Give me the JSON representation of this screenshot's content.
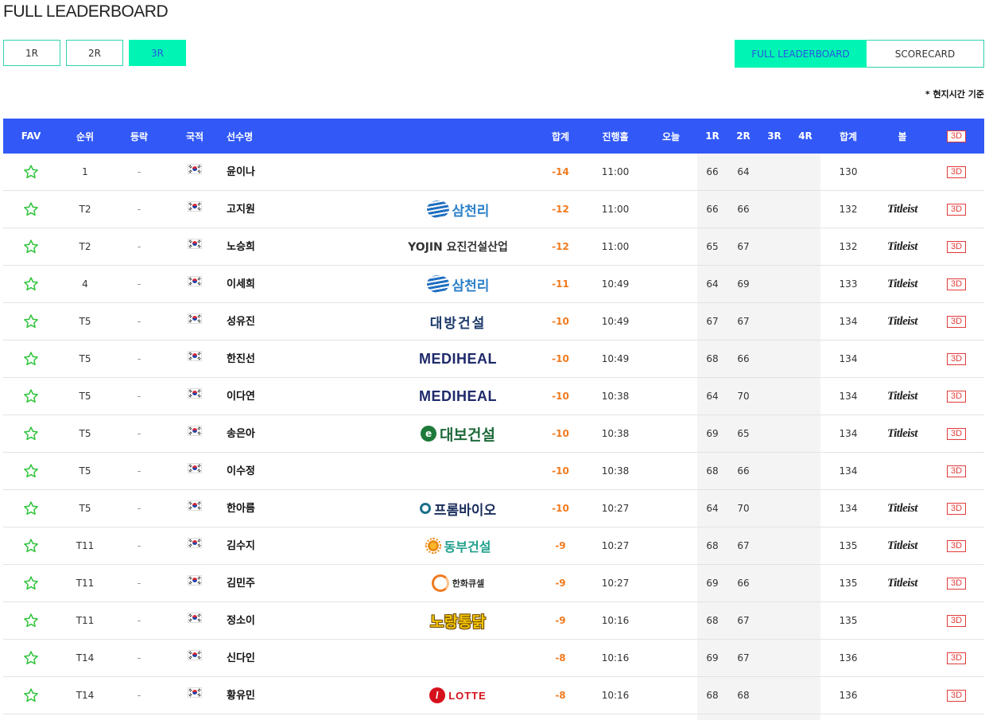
{
  "page_title": "FULL LEADERBOARD",
  "round_tabs": [
    "1R",
    "2R",
    "3R"
  ],
  "active_round": "3R",
  "view_tabs": {
    "leaderboard": "FULL LEADERBOARD",
    "scorecard": "SCORECARD"
  },
  "timezone_note": "* 현지시간 기준",
  "columns": {
    "fav": "FAV",
    "rank": "순위",
    "movement": "등락",
    "nation": "국적",
    "player": "선수명",
    "total": "합계",
    "hole": "진행홀",
    "today": "오늘",
    "r1": "1R",
    "r2": "2R",
    "r3": "3R",
    "r4": "4R",
    "sum": "합계",
    "ball": "볼",
    "three_d": "3D"
  },
  "colors": {
    "header_bg": "#3259f7",
    "accent": "#00f5b4",
    "score": "#f07a1e",
    "star": "#2fc43a",
    "three_d": "#e23b3b"
  },
  "rows": [
    {
      "rank": "1",
      "movement": "-",
      "nation_icon": "korea-flag-icon",
      "name": "윤이나",
      "sponsor": "",
      "total": "-14",
      "hole": "11:00",
      "today": "",
      "r1": "66",
      "r2": "64",
      "r3": "",
      "r4": "",
      "sum": "130",
      "ball": "",
      "three_d": "3D"
    },
    {
      "rank": "T2",
      "movement": "-",
      "nation_icon": "korea-flag-icon",
      "name": "고지원",
      "sponsor": "삼천리",
      "total": "-12",
      "hole": "11:00",
      "today": "",
      "r1": "66",
      "r2": "66",
      "r3": "",
      "r4": "",
      "sum": "132",
      "ball": "Titleist",
      "three_d": "3D"
    },
    {
      "rank": "T2",
      "movement": "-",
      "nation_icon": "korea-flag-icon",
      "name": "노승희",
      "sponsor": "YOJIN 요진건설산업",
      "total": "-12",
      "hole": "11:00",
      "today": "",
      "r1": "65",
      "r2": "67",
      "r3": "",
      "r4": "",
      "sum": "132",
      "ball": "Titleist",
      "three_d": "3D"
    },
    {
      "rank": "4",
      "movement": "-",
      "nation_icon": "korea-flag-icon",
      "name": "이세희",
      "sponsor": "삼천리",
      "total": "-11",
      "hole": "10:49",
      "today": "",
      "r1": "64",
      "r2": "69",
      "r3": "",
      "r4": "",
      "sum": "133",
      "ball": "Titleist",
      "three_d": "3D"
    },
    {
      "rank": "T5",
      "movement": "-",
      "nation_icon": "korea-flag-icon",
      "name": "성유진",
      "sponsor": "대방건설",
      "total": "-10",
      "hole": "10:49",
      "today": "",
      "r1": "67",
      "r2": "67",
      "r3": "",
      "r4": "",
      "sum": "134",
      "ball": "Titleist",
      "three_d": "3D"
    },
    {
      "rank": "T5",
      "movement": "-",
      "nation_icon": "korea-flag-icon",
      "name": "한진선",
      "sponsor": "MEDIHEAL",
      "total": "-10",
      "hole": "10:49",
      "today": "",
      "r1": "68",
      "r2": "66",
      "r3": "",
      "r4": "",
      "sum": "134",
      "ball": "",
      "three_d": "3D"
    },
    {
      "rank": "T5",
      "movement": "-",
      "nation_icon": "korea-flag-icon",
      "name": "이다연",
      "sponsor": "MEDIHEAL",
      "total": "-10",
      "hole": "10:38",
      "today": "",
      "r1": "64",
      "r2": "70",
      "r3": "",
      "r4": "",
      "sum": "134",
      "ball": "Titleist",
      "three_d": "3D"
    },
    {
      "rank": "T5",
      "movement": "-",
      "nation_icon": "korea-flag-icon",
      "name": "송은아",
      "sponsor": "대보건설",
      "total": "-10",
      "hole": "10:38",
      "today": "",
      "r1": "69",
      "r2": "65",
      "r3": "",
      "r4": "",
      "sum": "134",
      "ball": "Titleist",
      "three_d": "3D"
    },
    {
      "rank": "T5",
      "movement": "-",
      "nation_icon": "korea-flag-icon",
      "name": "이수정",
      "sponsor": "",
      "total": "-10",
      "hole": "10:38",
      "today": "",
      "r1": "68",
      "r2": "66",
      "r3": "",
      "r4": "",
      "sum": "134",
      "ball": "",
      "three_d": "3D"
    },
    {
      "rank": "T5",
      "movement": "-",
      "nation_icon": "korea-flag-icon",
      "name": "한아름",
      "sponsor": "프롬바이오",
      "total": "-10",
      "hole": "10:27",
      "today": "",
      "r1": "64",
      "r2": "70",
      "r3": "",
      "r4": "",
      "sum": "134",
      "ball": "Titleist",
      "three_d": "3D"
    },
    {
      "rank": "T11",
      "movement": "-",
      "nation_icon": "korea-flag-icon",
      "name": "김수지",
      "sponsor": "동부건설",
      "total": "-9",
      "hole": "10:27",
      "today": "",
      "r1": "68",
      "r2": "67",
      "r3": "",
      "r4": "",
      "sum": "135",
      "ball": "Titleist",
      "three_d": "3D"
    },
    {
      "rank": "T11",
      "movement": "-",
      "nation_icon": "korea-flag-icon",
      "name": "김민주",
      "sponsor": "한화큐셀",
      "total": "-9",
      "hole": "10:27",
      "today": "",
      "r1": "69",
      "r2": "66",
      "r3": "",
      "r4": "",
      "sum": "135",
      "ball": "Titleist",
      "three_d": "3D"
    },
    {
      "rank": "T11",
      "movement": "-",
      "nation_icon": "korea-flag-icon",
      "name": "정소이",
      "sponsor": "노랑통닭",
      "total": "-9",
      "hole": "10:16",
      "today": "",
      "r1": "68",
      "r2": "67",
      "r3": "",
      "r4": "",
      "sum": "135",
      "ball": "",
      "three_d": "3D"
    },
    {
      "rank": "T14",
      "movement": "-",
      "nation_icon": "korea-flag-icon",
      "name": "신다인",
      "sponsor": "",
      "total": "-8",
      "hole": "10:16",
      "today": "",
      "r1": "69",
      "r2": "67",
      "r3": "",
      "r4": "",
      "sum": "136",
      "ball": "",
      "three_d": "3D"
    },
    {
      "rank": "T14",
      "movement": "-",
      "nation_icon": "korea-flag-icon",
      "name": "황유민",
      "sponsor": "LOTTE",
      "total": "-8",
      "hole": "10:16",
      "today": "",
      "r1": "68",
      "r2": "68",
      "r3": "",
      "r4": "",
      "sum": "136",
      "ball": "",
      "three_d": "3D"
    }
  ]
}
